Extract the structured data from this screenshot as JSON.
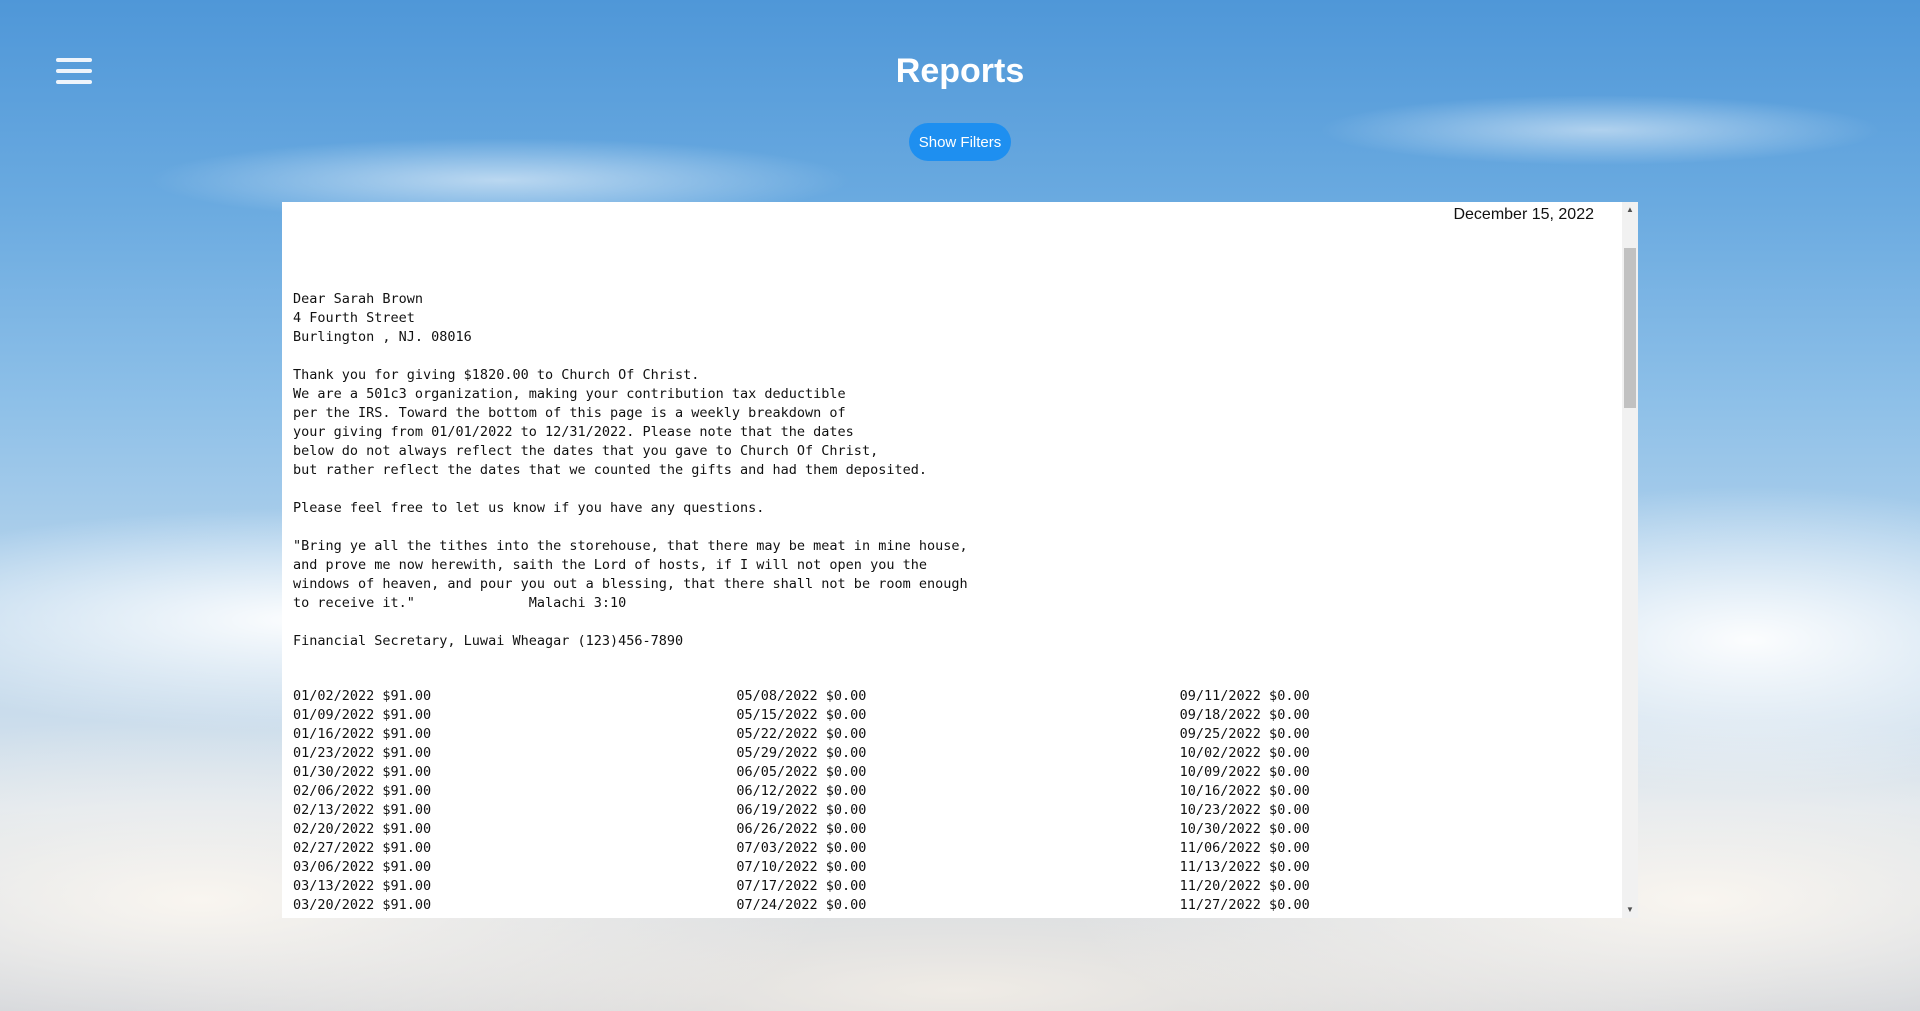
{
  "header": {
    "title": "Reports",
    "show_filters_label": "Show Filters"
  },
  "report": {
    "date": "December 15, 2022",
    "letter": [
      "Dear Sarah Brown",
      "4 Fourth Street",
      "Burlington , NJ. 08016",
      "",
      "Thank you for giving $1820.00 to Church Of Christ.",
      "We are a 501c3 organization, making your contribution tax deductible",
      "per the IRS. Toward the bottom of this page is a weekly breakdown of",
      "your giving from 01/01/2022 to 12/31/2022. Please note that the dates",
      "below do not always reflect the dates that you gave to Church Of Christ,",
      "but rather reflect the dates that we counted the gifts and had them deposited.",
      "",
      "Please feel free to let us know if you have any questions.",
      "",
      "\"Bring ye all the tithes into the storehouse, that there may be meat in mine house,",
      "and prove me now herewith, saith the Lord of hosts, if I will not open you the",
      "windows of heaven, and pour you out a blessing, that there shall not be room enough",
      "to receive it.\"              Malachi 3:10",
      "",
      "Financial Secretary, Luwai Wheagar (123)456-7890"
    ],
    "weekly": [
      [
        "01/02/2022 $91.00",
        "01/09/2022 $91.00",
        "01/16/2022 $91.00",
        "01/23/2022 $91.00",
        "01/30/2022 $91.00",
        "02/06/2022 $91.00",
        "02/13/2022 $91.00",
        "02/20/2022 $91.00",
        "02/27/2022 $91.00",
        "03/06/2022 $91.00",
        "03/13/2022 $91.00",
        "03/20/2022 $91.00"
      ],
      [
        "05/08/2022 $0.00",
        "05/15/2022 $0.00",
        "05/22/2022 $0.00",
        "05/29/2022 $0.00",
        "06/05/2022 $0.00",
        "06/12/2022 $0.00",
        "06/19/2022 $0.00",
        "06/26/2022 $0.00",
        "07/03/2022 $0.00",
        "07/10/2022 $0.00",
        "07/17/2022 $0.00",
        "07/24/2022 $0.00"
      ],
      [
        "09/11/2022 $0.00",
        "09/18/2022 $0.00",
        "09/25/2022 $0.00",
        "10/02/2022 $0.00",
        "10/09/2022 $0.00",
        "10/16/2022 $0.00",
        "10/23/2022 $0.00",
        "10/30/2022 $0.00",
        "11/06/2022 $0.00",
        "11/13/2022 $0.00",
        "11/20/2022 $0.00",
        "11/27/2022 $0.00"
      ]
    ]
  },
  "icons": {
    "menu": "hamburger-menu-icon",
    "scroll_up": "scroll-up-arrow-icon",
    "scroll_down": "scroll-down-arrow-icon"
  }
}
